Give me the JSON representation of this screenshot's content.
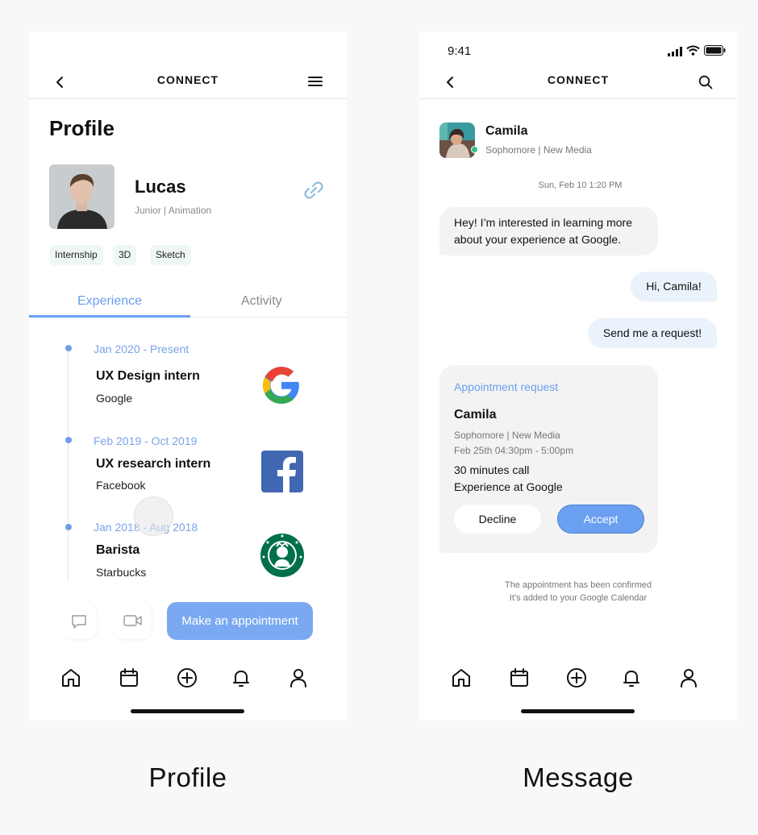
{
  "profile_screen": {
    "caption": "Profile",
    "nav": {
      "title": "CONNECT"
    },
    "heading": "Profile",
    "user": {
      "name": "Lucas",
      "subtitle": "Junior | Animation"
    },
    "tags": [
      "Internship",
      "3D",
      "Sketch"
    ],
    "tabs": [
      {
        "label": "Experience",
        "active": true
      },
      {
        "label": "Activity",
        "active": false
      }
    ],
    "experience": [
      {
        "date": "Jan 2020 - Present",
        "title": "UX Design intern",
        "company": "Google",
        "logo": "google-logo"
      },
      {
        "date": "Feb 2019 - Oct 2019",
        "title": "UX research intern",
        "company": "Facebook",
        "logo": "facebook-logo"
      },
      {
        "date": "Jan 2018 - Aug 2018",
        "title": "Barista",
        "company": "Starbucks",
        "logo": "starbucks-logo"
      }
    ],
    "appointment_button": "Make an appointment",
    "action_icons": [
      "chat-icon",
      "video-icon"
    ],
    "tab_bar": [
      "home-icon",
      "calendar-icon",
      "add-icon",
      "bell-icon",
      "user-icon"
    ]
  },
  "message_screen": {
    "caption": "Message",
    "status_bar": {
      "time": "9:41"
    },
    "nav": {
      "title": "CONNECT"
    },
    "contact": {
      "name": "Camila",
      "subtitle": "Sophomore | New Media",
      "online": true
    },
    "timestamp": "Sun, Feb 10 1:20 PM",
    "messages": [
      {
        "direction": "in",
        "lines": [
          "Hey! I’m interested in learning more",
          "about your experience at Google."
        ]
      },
      {
        "direction": "out",
        "text": "Hi, Camila!"
      },
      {
        "direction": "out",
        "text": "Send me a request!"
      }
    ],
    "request": {
      "heading": "Appointment request",
      "name": "Camila",
      "subtitle": "Sophomore | New Media",
      "time": "Feb 25th 04:30pm - 5:00pm",
      "duration": "30 minutes call",
      "topic": "Experience at Google",
      "decline_label": "Decline",
      "accept_label": "Accept"
    },
    "confirmation": [
      "The appointment has been confirmed",
      "It’s added to your Google Calendar"
    ],
    "tab_bar": [
      "home-icon",
      "calendar-icon",
      "add-icon",
      "bell-icon",
      "user-icon"
    ]
  },
  "colors": {
    "accent": "#6b9ff0",
    "accent_text": "#7aa3e8",
    "chip_bg": "#eef7f5",
    "online": "#2bc38a"
  }
}
